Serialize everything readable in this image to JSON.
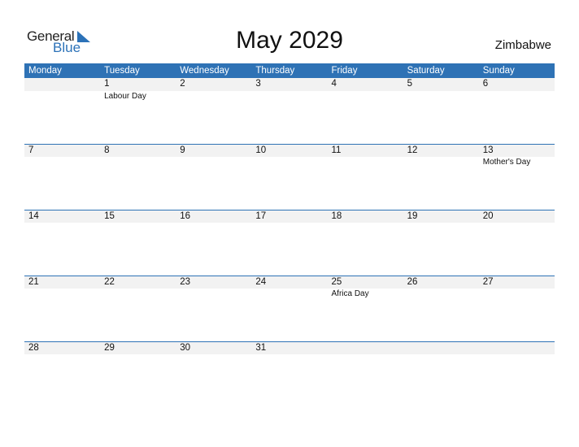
{
  "logo": {
    "general": "General",
    "blue": "Blue"
  },
  "title": "May 2029",
  "country": "Zimbabwe",
  "days": [
    "Monday",
    "Tuesday",
    "Wednesday",
    "Thursday",
    "Friday",
    "Saturday",
    "Sunday"
  ],
  "weeks": [
    {
      "dates": [
        "",
        "1",
        "2",
        "3",
        "4",
        "5",
        "6"
      ],
      "events": [
        "",
        "Labour Day",
        "",
        "",
        "",
        "",
        ""
      ]
    },
    {
      "dates": [
        "7",
        "8",
        "9",
        "10",
        "11",
        "12",
        "13"
      ],
      "events": [
        "",
        "",
        "",
        "",
        "",
        "",
        "Mother's Day"
      ]
    },
    {
      "dates": [
        "14",
        "15",
        "16",
        "17",
        "18",
        "19",
        "20"
      ],
      "events": [
        "",
        "",
        "",
        "",
        "",
        "",
        ""
      ]
    },
    {
      "dates": [
        "21",
        "22",
        "23",
        "24",
        "25",
        "26",
        "27"
      ],
      "events": [
        "",
        "",
        "",
        "",
        "Africa Day",
        "",
        ""
      ]
    },
    {
      "dates": [
        "28",
        "29",
        "30",
        "31",
        "",
        "",
        ""
      ],
      "events": [
        "",
        "",
        "",
        "",
        "",
        "",
        ""
      ]
    }
  ]
}
